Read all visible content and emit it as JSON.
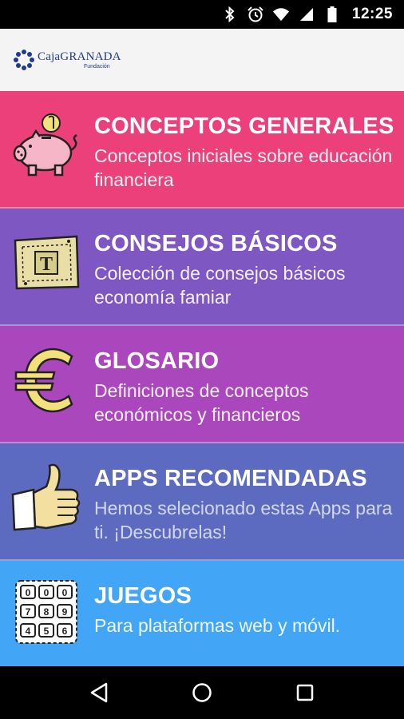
{
  "status_bar": {
    "time": "12:25",
    "icons": [
      "bluetooth-icon",
      "alarm-icon",
      "wifi-icon",
      "signal-icon",
      "battery-icon"
    ]
  },
  "header": {
    "logo": {
      "name_prefix": "Caja",
      "name_main": "GRANADA",
      "subtitle": "Fundación",
      "color": "#1f3a8f"
    }
  },
  "menu": {
    "items": [
      {
        "title": "CONCEPTOS GENERALES",
        "description": "Conceptos iniciales sobre educación financiera",
        "color": "#ec407a",
        "icon": "piggy-bank-icon"
      },
      {
        "title": "CONSEJOS BÁSICOS",
        "description": "Colección de consejos básicos economía famiar",
        "color": "#7e57c2",
        "icon": "banknote-icon"
      },
      {
        "title": "GLOSARIO",
        "description": "Definiciones de conceptos económicos y financieros",
        "color": "#ab47bc",
        "icon": "euro-icon"
      },
      {
        "title": "APPS RECOMENDADAS",
        "description": "Hemos selecionado estas Apps para ti. ¡Descubrelas!",
        "color": "#5c6bc0",
        "icon": "thumbs-up-icon"
      },
      {
        "title": "JUEGOS",
        "description": "Para plataformas web y móvil.",
        "color": "#42a5f5",
        "icon": "keypad-icon"
      }
    ]
  },
  "nav_bar": {
    "buttons": [
      "back-icon",
      "home-icon",
      "recents-icon"
    ]
  }
}
